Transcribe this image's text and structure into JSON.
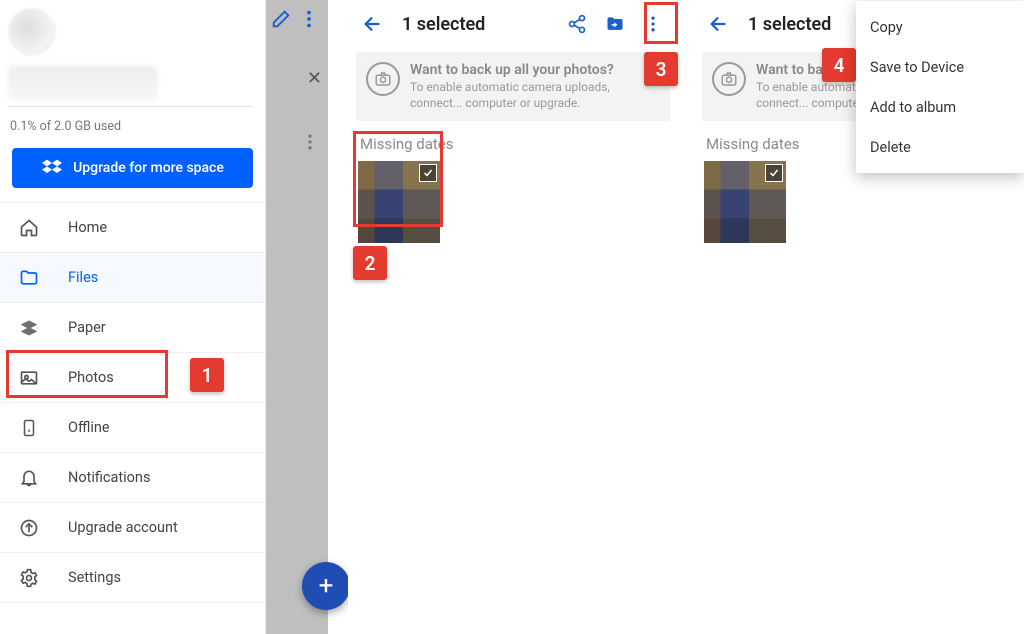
{
  "panel1": {
    "storage_text": "0.1% of 2.0 GB used",
    "upgrade_label": "Upgrade for more space",
    "nav": {
      "home": "Home",
      "files": "Files",
      "paper": "Paper",
      "photos": "Photos",
      "offline": "Offline",
      "notifications": "Notifications",
      "upgrade_account": "Upgrade account",
      "settings": "Settings"
    }
  },
  "selection": {
    "title": "1 selected",
    "banner_title": "Want to back up all your photos?",
    "banner_sub_full": "To enable automatic camera uploads, connect a computer or upgrade.",
    "banner_sub_short": "To enable automatic camera uploads, connect... computer or upgrade.",
    "section": "Missing dates"
  },
  "menu": {
    "copy": "Copy",
    "save": "Save to Device",
    "add_album": "Add to album",
    "delete": "Delete"
  },
  "annotations": {
    "n1": "1",
    "n2": "2",
    "n3": "3",
    "n4": "4"
  },
  "colors": {
    "primary_blue": "#0061fe",
    "annotation_red": "#e53a2f",
    "fab_blue": "#1f4db3"
  }
}
